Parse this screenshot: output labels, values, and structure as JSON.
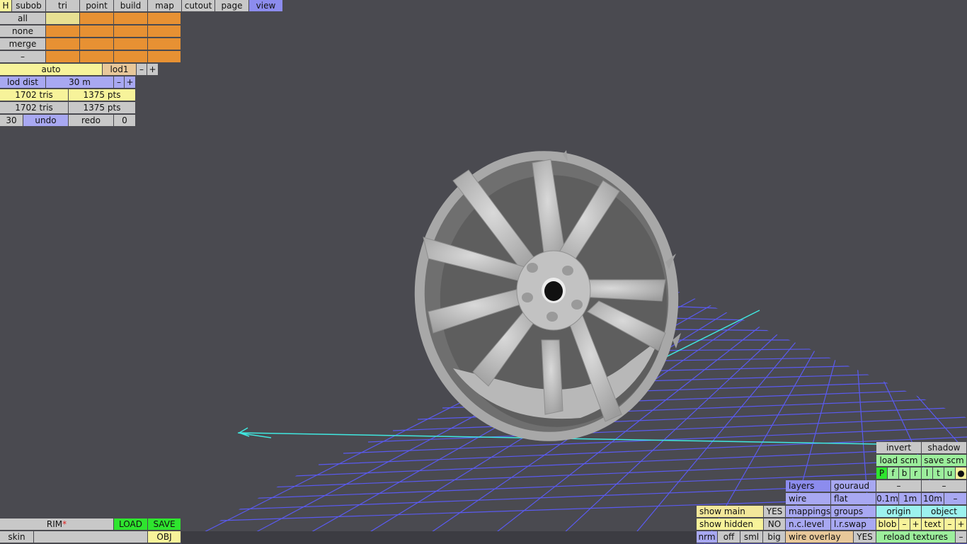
{
  "menu": {
    "h": "H",
    "tabs": [
      "subob",
      "tri",
      "point",
      "build",
      "map",
      "cutout",
      "page",
      "view"
    ]
  },
  "select_panel": {
    "rows": [
      "all",
      "none",
      "merge",
      "–"
    ]
  },
  "lod": {
    "mode": "auto",
    "level": "lod1",
    "minus": "–",
    "plus": "+",
    "dist_label": "lod dist",
    "dist_value": "30 m"
  },
  "stats": {
    "row1": {
      "tris": "1702 tris",
      "pts": "1375 pts"
    },
    "row2": {
      "tris": "1702 tris",
      "pts": "1375 pts"
    }
  },
  "history": {
    "count": "30",
    "undo": "undo",
    "redo": "redo",
    "redo_count": "0"
  },
  "file": {
    "name": "RIM",
    "modified_mark": "*",
    "load": "LOAD",
    "save": "SAVE",
    "skin": "skin",
    "format": "OBJ"
  },
  "display": {
    "show_main": "show main",
    "show_main_value": "YES",
    "show_hidden": "show hidden",
    "show_hidden_value": "NO",
    "nrm": "nrm",
    "off": "off",
    "sml": "sml",
    "big": "big",
    "layers": "layers",
    "gouraud": "gouraud",
    "wire": "wire",
    "flat": "flat",
    "mappings": "mappings",
    "groups": "groups",
    "nc_level": "n.c.level",
    "lr_swap": "l.r.swap",
    "wire_overlay": "wire overlay",
    "wire_overlay_value": "YES"
  },
  "tools": {
    "invert": "invert",
    "shadow": "shadow",
    "load_scm": "load scm",
    "save_scm": "save scm",
    "views": [
      "P",
      "f",
      "b",
      "r",
      "l",
      "t",
      "u"
    ],
    "dot": "●",
    "dash1": "–",
    "dash2": "–",
    "grid": [
      "0.1m",
      "1m",
      "10m"
    ],
    "grid_minus": "–",
    "origin": "origin",
    "object": "object",
    "blob": "blob",
    "text": "text",
    "minus": "–",
    "plus": "+",
    "reload_textures": "reload textures"
  }
}
